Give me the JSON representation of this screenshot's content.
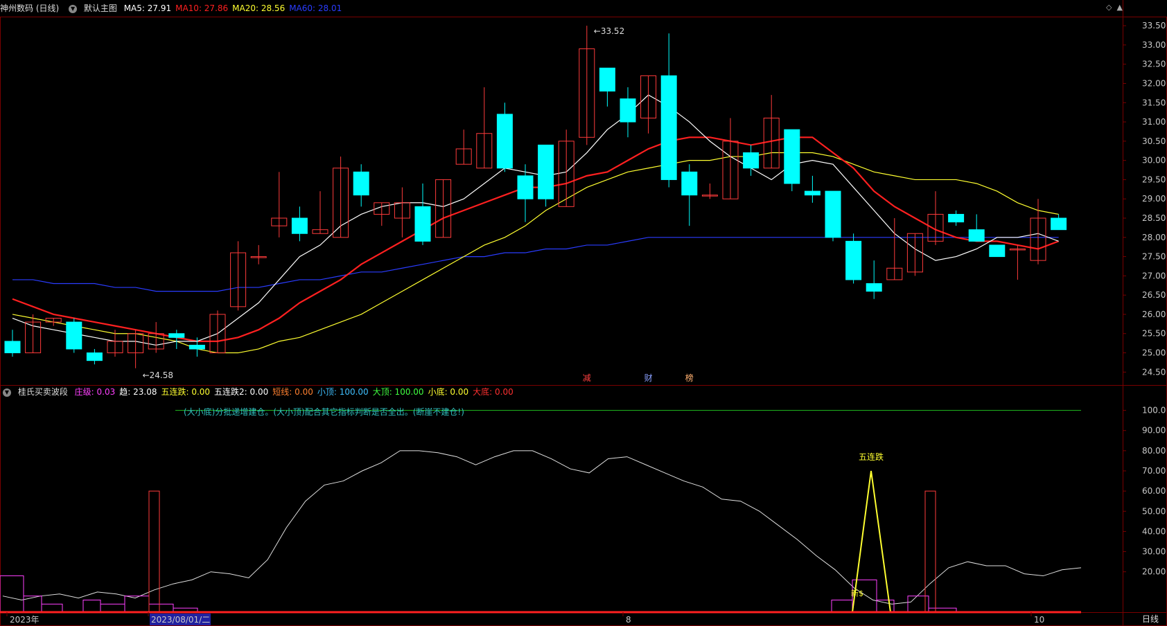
{
  "main_panel": {
    "stock_name": "神州数码 (日线)",
    "template": "默认主图",
    "ma_labels": [
      {
        "text": "MA5: 27.91",
        "color": "#ffffff"
      },
      {
        "text": "MA10: 27.86",
        "color": "#ff2020"
      },
      {
        "text": "MA20: 28.56",
        "color": "#ffff30"
      },
      {
        "text": "MA60: 28.01",
        "color": "#2a3cff"
      }
    ],
    "high_label": "33.52",
    "low_label": "24.58",
    "markers": [
      {
        "text": "减",
        "color": "#ff4040"
      },
      {
        "text": "财",
        "color": "#8aa0ff"
      },
      {
        "text": "榜",
        "color": "#ffb070"
      }
    ]
  },
  "indicator_panel": {
    "name": "桂氏买卖波段",
    "values": [
      {
        "text": "庄级: 0.03",
        "color": "#ff40ff"
      },
      {
        "text": "趋: 23.08",
        "color": "#ffffff"
      },
      {
        "text": "五连跌: 0.00",
        "color": "#ffff30"
      },
      {
        "text": "五连跌2: 0.00",
        "color": "#ffffff"
      },
      {
        "text": "短线: 0.00",
        "color": "#ff8030"
      },
      {
        "text": "小顶: 100.00",
        "color": "#40c0ff"
      },
      {
        "text": "大顶: 100.00",
        "color": "#40ff40"
      },
      {
        "text": "小底: 0.00",
        "color": "#ffff30"
      },
      {
        "text": "大底: 0.00",
        "color": "#ff3030"
      }
    ],
    "note": "(大小底)分批递增建仓。(大小顶)配合其它指标判断是否全出。(断崖不建仓!)",
    "annotation_top": "五连跌",
    "annotation_small": "新$"
  },
  "x_axis": {
    "labels": [
      "2023年",
      "2023/08/01/二",
      "8",
      "10"
    ],
    "period": "日线"
  },
  "chart_data": [
    {
      "type": "candlestick",
      "title": "神州数码 (日线)",
      "ylim": [
        24.2,
        33.7
      ],
      "y_ticks": [
        "33.50",
        "33.00",
        "32.50",
        "32.00",
        "31.50",
        "31.00",
        "30.50",
        "30.00",
        "29.50",
        "29.00",
        "28.50",
        "28.00",
        "27.50",
        "27.00",
        "26.50",
        "26.00",
        "25.50",
        "25.00",
        "24.50"
      ],
      "candles": [
        [
          25.3,
          25.0,
          25.6,
          24.9
        ],
        [
          25.0,
          25.8,
          26.0,
          25.0
        ],
        [
          25.8,
          25.9,
          25.9,
          25.7
        ],
        [
          25.8,
          25.1,
          25.9,
          25.0
        ],
        [
          25.0,
          24.8,
          25.1,
          24.7
        ],
        [
          25.0,
          25.3,
          25.6,
          24.9
        ],
        [
          25.0,
          25.5,
          25.6,
          24.6
        ],
        [
          25.1,
          25.5,
          25.8,
          25.0
        ],
        [
          25.5,
          25.4,
          25.6,
          25.1
        ],
        [
          25.2,
          25.1,
          25.4,
          24.9
        ],
        [
          25.0,
          26.0,
          26.1,
          25.0
        ],
        [
          26.2,
          27.6,
          27.9,
          26.1
        ],
        [
          27.5,
          27.5,
          27.8,
          27.3
        ],
        [
          28.3,
          28.5,
          29.7,
          28.0
        ],
        [
          28.5,
          28.1,
          28.8,
          27.9
        ],
        [
          28.1,
          28.2,
          29.2,
          28.1
        ],
        [
          28.0,
          29.8,
          30.1,
          28.0
        ],
        [
          29.7,
          29.1,
          29.9,
          28.8
        ],
        [
          28.6,
          28.9,
          28.9,
          28.3
        ],
        [
          28.5,
          28.9,
          29.3,
          28.0
        ],
        [
          28.8,
          27.9,
          29.4,
          27.8
        ],
        [
          28.0,
          29.5,
          29.5,
          28.0
        ],
        [
          29.9,
          30.3,
          30.8,
          29.9
        ],
        [
          29.8,
          30.7,
          31.9,
          29.8
        ],
        [
          31.2,
          29.8,
          31.5,
          29.7
        ],
        [
          29.6,
          29.0,
          29.9,
          28.4
        ],
        [
          30.4,
          29.0,
          30.4,
          28.8
        ],
        [
          28.8,
          30.5,
          30.8,
          28.8
        ],
        [
          30.6,
          32.9,
          33.5,
          30.4
        ],
        [
          32.4,
          31.8,
          32.4,
          31.4
        ],
        [
          31.6,
          31.0,
          31.9,
          30.6
        ],
        [
          31.1,
          32.2,
          32.2,
          30.7
        ],
        [
          32.2,
          29.5,
          33.3,
          29.3
        ],
        [
          29.7,
          29.1,
          29.9,
          28.3
        ],
        [
          29.1,
          29.1,
          29.4,
          29.0
        ],
        [
          29.0,
          30.5,
          31.1,
          29.0
        ],
        [
          30.2,
          29.8,
          30.4,
          29.6
        ],
        [
          29.8,
          31.1,
          31.7,
          29.8
        ],
        [
          30.8,
          29.4,
          30.8,
          29.2
        ],
        [
          29.2,
          29.1,
          29.6,
          28.9
        ],
        [
          29.2,
          28.0,
          29.2,
          27.9
        ],
        [
          27.9,
          26.9,
          28.1,
          26.8
        ],
        [
          26.8,
          26.6,
          27.4,
          26.4
        ],
        [
          26.9,
          27.2,
          28.5,
          26.9
        ],
        [
          27.1,
          28.1,
          28.1,
          27.0
        ],
        [
          27.9,
          28.6,
          29.2,
          27.8
        ],
        [
          28.6,
          28.4,
          28.7,
          28.3
        ],
        [
          28.2,
          27.9,
          28.6,
          27.9
        ],
        [
          27.8,
          27.5,
          27.8,
          27.5
        ],
        [
          27.7,
          27.7,
          27.8,
          26.9
        ],
        [
          27.4,
          28.5,
          29.0,
          27.3
        ],
        [
          28.5,
          28.2,
          28.6,
          28.2
        ]
      ],
      "ma5": [
        25.9,
        25.7,
        25.6,
        25.5,
        25.4,
        25.3,
        25.3,
        25.2,
        25.3,
        25.3,
        25.5,
        25.9,
        26.3,
        26.9,
        27.5,
        27.8,
        28.3,
        28.6,
        28.8,
        28.9,
        28.9,
        28.8,
        29.0,
        29.4,
        29.8,
        29.7,
        29.6,
        29.7,
        30.2,
        30.8,
        31.2,
        31.7,
        31.4,
        31.0,
        30.5,
        30.1,
        29.8,
        29.5,
        29.9,
        30.0,
        29.9,
        29.3,
        28.7,
        28.1,
        27.7,
        27.4,
        27.5,
        27.7,
        28.0,
        28.0,
        28.1,
        27.9
      ],
      "ma10": [
        26.4,
        26.2,
        26.0,
        25.9,
        25.8,
        25.7,
        25.6,
        25.5,
        25.4,
        25.3,
        25.3,
        25.4,
        25.6,
        25.9,
        26.3,
        26.6,
        26.9,
        27.3,
        27.6,
        27.9,
        28.2,
        28.5,
        28.7,
        28.9,
        29.1,
        29.3,
        29.3,
        29.4,
        29.6,
        29.7,
        30.0,
        30.3,
        30.5,
        30.6,
        30.6,
        30.5,
        30.4,
        30.5,
        30.6,
        30.6,
        30.2,
        29.8,
        29.2,
        28.8,
        28.5,
        28.2,
        28.0,
        27.9,
        27.9,
        27.8,
        27.7,
        27.9
      ],
      "ma20": [
        26.0,
        25.9,
        25.8,
        25.7,
        25.6,
        25.5,
        25.5,
        25.4,
        25.3,
        25.1,
        25.0,
        25.0,
        25.1,
        25.3,
        25.4,
        25.6,
        25.8,
        26.0,
        26.3,
        26.6,
        26.9,
        27.2,
        27.5,
        27.8,
        28.0,
        28.3,
        28.7,
        29.0,
        29.3,
        29.5,
        29.7,
        29.8,
        29.9,
        30.0,
        30.0,
        30.1,
        30.1,
        30.2,
        30.2,
        30.2,
        30.1,
        29.9,
        29.7,
        29.6,
        29.5,
        29.5,
        29.5,
        29.4,
        29.2,
        28.9,
        28.7,
        28.6
      ],
      "ma60": [
        26.9,
        26.9,
        26.8,
        26.8,
        26.8,
        26.7,
        26.7,
        26.6,
        26.6,
        26.6,
        26.6,
        26.7,
        26.7,
        26.8,
        26.9,
        26.9,
        27.0,
        27.1,
        27.1,
        27.2,
        27.3,
        27.4,
        27.5,
        27.5,
        27.6,
        27.6,
        27.7,
        27.7,
        27.8,
        27.8,
        27.9,
        28.0,
        28.0,
        28.0,
        28.0,
        28.0,
        28.0,
        28.0,
        28.0,
        28.0,
        28.0,
        28.0,
        28.0,
        28.0,
        28.0,
        28.0,
        28.0,
        28.0,
        28.0,
        28.0,
        28.0,
        28.0
      ]
    },
    {
      "type": "line",
      "title": "桂氏买卖波段",
      "ylim": [
        0,
        105
      ],
      "y_ticks": [
        "100.0",
        "90.00",
        "80.00",
        "70.00",
        "60.00",
        "50.00",
        "40.00",
        "30.00",
        "20.00"
      ],
      "trend": [
        8,
        6,
        8,
        9,
        7,
        10,
        9,
        7,
        11,
        14,
        16,
        20,
        19,
        17,
        26,
        42,
        55,
        63,
        65,
        70,
        74,
        80,
        80,
        79,
        77,
        73,
        77,
        80,
        80,
        76,
        71,
        69,
        76,
        77,
        73,
        69,
        65,
        62,
        56,
        55,
        50,
        43,
        36,
        28,
        21,
        12,
        6,
        4,
        5,
        14,
        22,
        25,
        23,
        23,
        19,
        18,
        21,
        22
      ]
    }
  ],
  "colors": {
    "up": "#ff3b3b",
    "down": "#00ffff",
    "grid": "#7a0000",
    "axis_text": "#c8c8c8"
  }
}
